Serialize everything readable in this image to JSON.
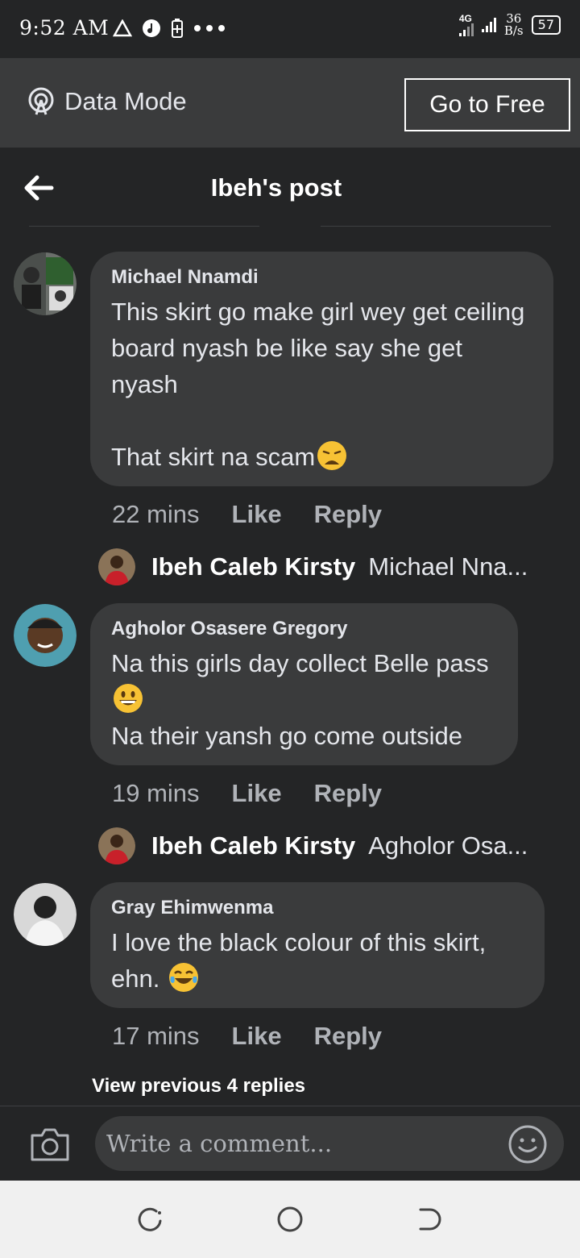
{
  "status_bar": {
    "time": "9:52 AM",
    "network_type": "4G",
    "net_speed_value": "36",
    "net_speed_unit": "B/s",
    "battery": "57"
  },
  "data_mode": {
    "label": "Data Mode",
    "go_free_label": "Go to Free"
  },
  "header": {
    "title": "Ibeh's post"
  },
  "comments": [
    {
      "author": "Michael Nnamdi",
      "text": "This skirt go make girl wey get ceiling board nyash be like say she get nyash\n\nThat skirt na scam",
      "time": "22 mins",
      "like": "Like",
      "reply": "Reply",
      "reply_preview": {
        "name": "Ibeh Caleb Kirsty",
        "text": "Michael Nna..."
      }
    },
    {
      "author": "Agholor Osasere Gregory",
      "text_line1": "Na this girls day collect Belle pass",
      "text_line2": "Na their yansh go come outside",
      "time": "19 mins",
      "like": "Like",
      "reply": "Reply",
      "reply_preview": {
        "name": "Ibeh Caleb Kirsty",
        "text": "Agholor Osa..."
      }
    },
    {
      "author": "Gray Ehimwenma",
      "text": "I love the black colour of this skirt, ehn. ",
      "time": "17 mins",
      "like": "Like",
      "reply": "Reply"
    }
  ],
  "view_previous_replies": "View previous 4 replies",
  "composer": {
    "placeholder": "Write a comment..."
  },
  "colors": {
    "background": "#242526",
    "bubble": "#3a3b3c",
    "secondary_text": "#b0b3b8",
    "nav_bar": "#f0f0f0"
  },
  "icons": [
    "data-mode-icon",
    "back-arrow-icon",
    "camera-icon",
    "smiley-icon",
    "weary-face-emoji",
    "grinning-face-emoji",
    "tears-of-joy-emoji",
    "nav-recents-icon",
    "nav-home-icon",
    "nav-back-icon"
  ]
}
